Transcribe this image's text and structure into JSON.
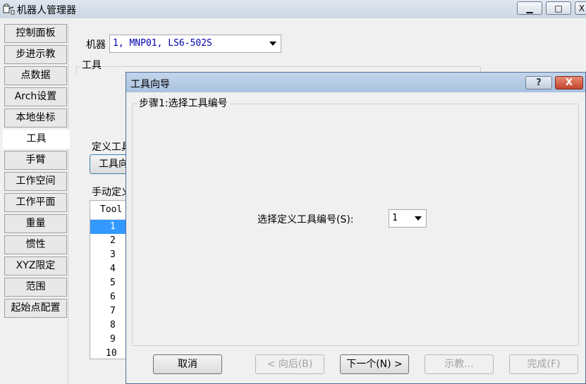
{
  "window": {
    "title": "机器人管理器",
    "controls": [
      "minimize-icon",
      "maximize-icon",
      "close-icon"
    ]
  },
  "tabs": [
    {
      "label": "控制面板",
      "active": false
    },
    {
      "label": "步进示教",
      "active": false
    },
    {
      "label": "点数据",
      "active": false
    },
    {
      "label": "Arch设置",
      "active": false
    },
    {
      "label": "本地坐标",
      "active": false
    },
    {
      "label": "工具",
      "active": true
    },
    {
      "label": "手臂",
      "active": false
    },
    {
      "label": "工作空间",
      "active": false
    },
    {
      "label": "工作平面",
      "active": false
    },
    {
      "label": "重量",
      "active": false
    },
    {
      "label": "惯性",
      "active": false
    },
    {
      "label": "XYZ限定",
      "active": false
    },
    {
      "label": "范围",
      "active": false
    },
    {
      "label": "起始点配置",
      "active": false
    }
  ],
  "main": {
    "robot_label": "机器",
    "robot_value": "1, MNP01, LS6-502S",
    "tools_group_title": "工具",
    "define_tool_label": "定义工具",
    "tool_wizard_button": "工具向",
    "manual_define_label": "手动定义",
    "tool_list": {
      "header": "Tool",
      "rows": [
        "1",
        "2",
        "3",
        "4",
        "5",
        "6",
        "7",
        "8",
        "9",
        "10"
      ],
      "selected": "1"
    }
  },
  "dialog": {
    "title": "工具向导",
    "help": "?",
    "close": "X",
    "step_title": "步骤1:选择工具编号",
    "select_label": "选择定义工具编号(S):",
    "select_value": "1",
    "buttons": {
      "cancel": "取消",
      "back": "< 向后(B)",
      "next": "下一个(N) >",
      "teach": "示教...",
      "finish": "完成(F)"
    }
  }
}
